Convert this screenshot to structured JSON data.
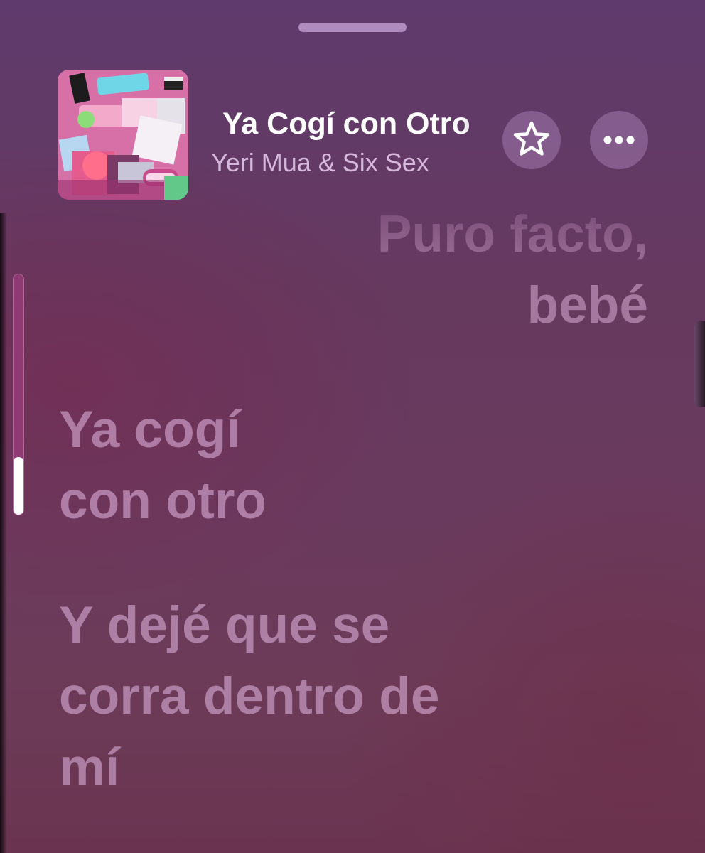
{
  "theme": {
    "accent_text": "#ffffff",
    "artist_color": "#d7b8dc",
    "lyric_color": "#d6aad4"
  },
  "now_playing": {
    "title": "Ya Cogí con Otro",
    "artist": "Yeri Mua & Six Sex",
    "artwork_icon": "album-artwork",
    "favorite_icon": "star-outline-icon",
    "more_icon": "ellipsis-icon"
  },
  "lyrics": [
    {
      "lines": [
        "Puro facto,",
        "bebé"
      ],
      "state": "past"
    },
    {
      "lines": [
        "Ya cogí",
        "con otro"
      ],
      "state": "upcoming"
    },
    {
      "lines": [
        "Y dejé que se",
        "corra dentro de",
        "mí"
      ],
      "state": "upcoming"
    }
  ],
  "volume": {
    "level": 0.24
  }
}
